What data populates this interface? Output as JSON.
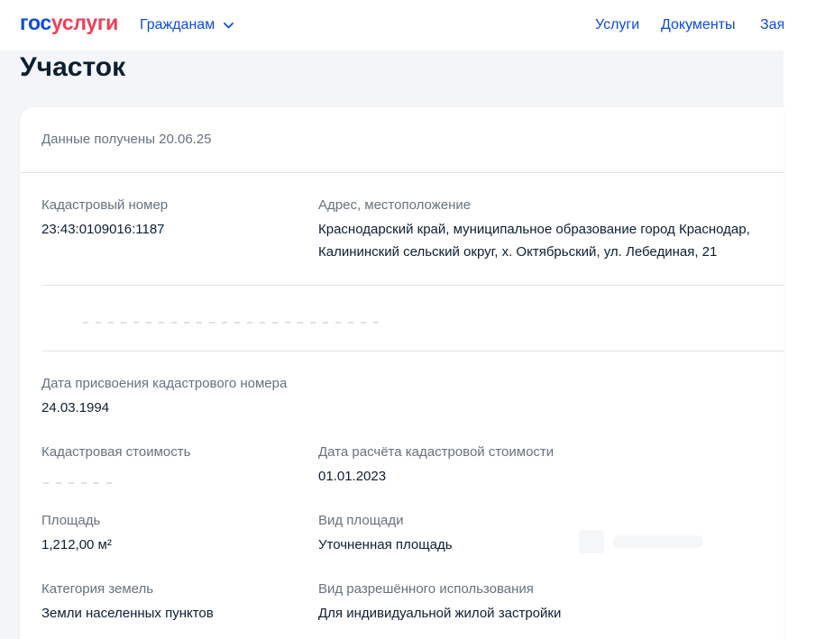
{
  "header": {
    "logo_part1": "гос",
    "logo_part2": "услуги",
    "nav_citizens": "Гражданам",
    "nav_services": "Услуги",
    "nav_documents": "Документы",
    "nav_applications": "Зая",
    "accent_color": "#0d4cd3",
    "logo_red": "#ee3f58"
  },
  "page": {
    "title": "Участок"
  },
  "card": {
    "received": "Данные получены 20.06.25",
    "fields": {
      "cadastral_number_label": "Кадастровый номер",
      "cadastral_number": "23:43:0109016:1187",
      "address_label": "Адрес, местоположение",
      "address_line1": "Краснодарский край, муниципальное образование город Краснодар,",
      "address_line2": "Калининский сельский округ, х. Октябрьский, ул. Лебединая, 21",
      "assign_date_label": "Дата присвоения кадастрового номера",
      "assign_date": "24.03.1994",
      "cost_label": "Кадастровая стоимость",
      "cost_calc_date_label": "Дата расчёта кадастровой стоимости",
      "cost_calc_date": "01.01.2023",
      "area_label": "Площадь",
      "area": "1,212,00 м²",
      "area_type_label": "Вид площади",
      "area_type": "Уточненная площадь",
      "land_category_label": "Категория земель",
      "land_category": "Земли населенных пунктов",
      "permitted_use_label": "Вид разрешённого использования",
      "permitted_use": "Для индивидуальной жилой застройки"
    }
  }
}
